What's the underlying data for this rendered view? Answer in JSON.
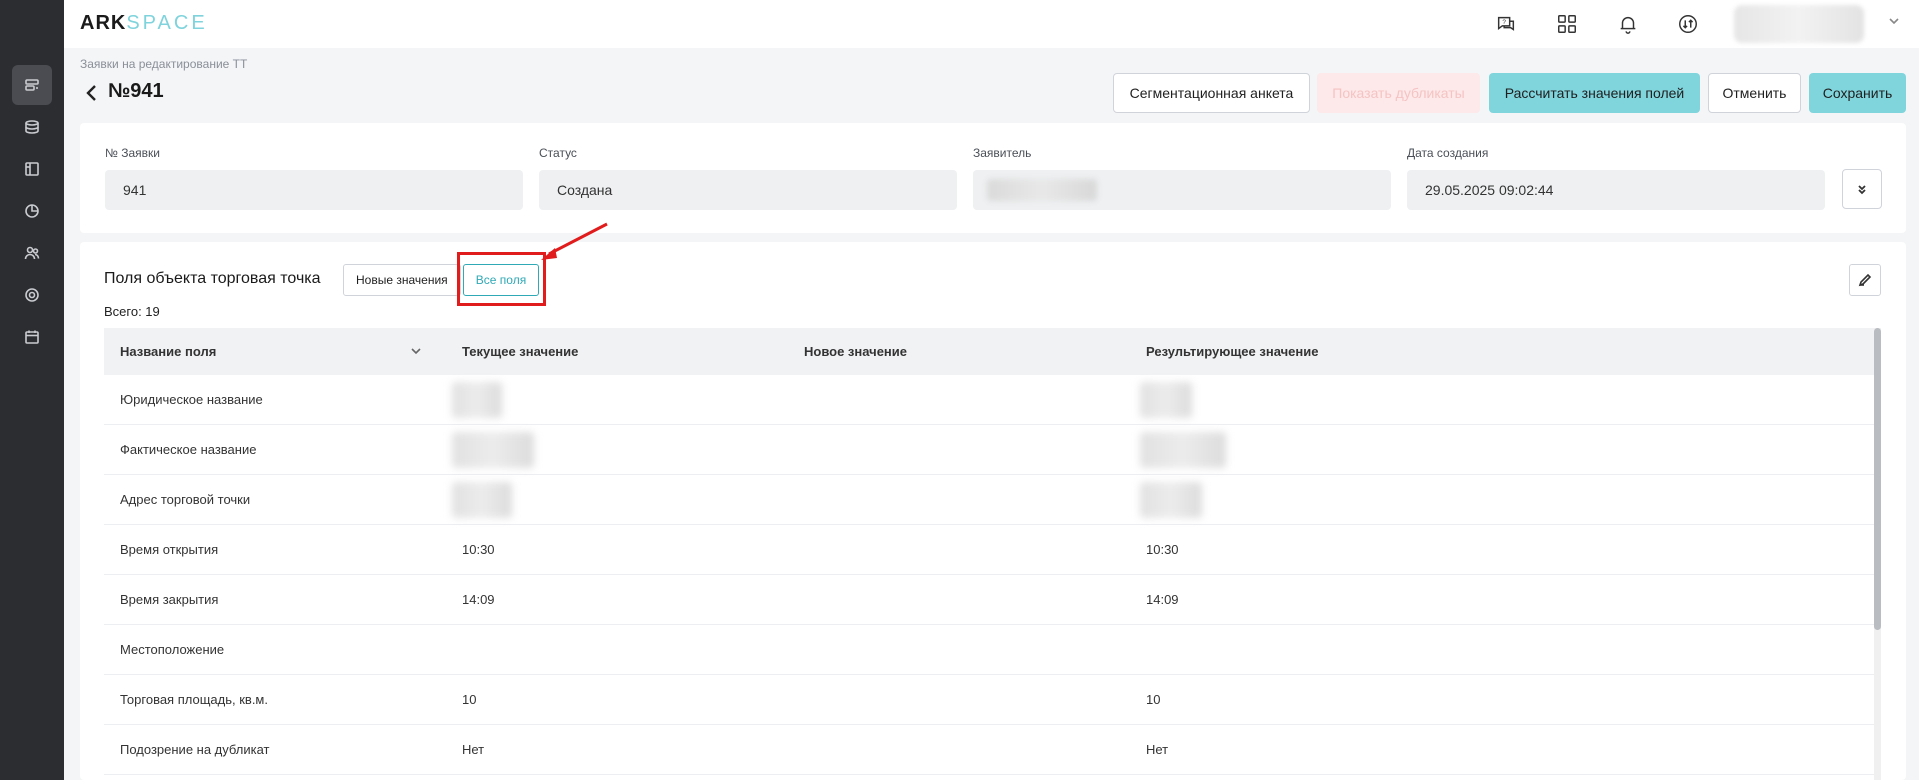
{
  "app": {
    "logo_ark": "ARK",
    "logo_space": "SPACE"
  },
  "header": {
    "icons": [
      "support-chat-icon",
      "apps-grid-icon",
      "bell-icon",
      "sync-icon"
    ]
  },
  "sidebar": {
    "items": [
      "requests-icon",
      "database-icon",
      "layout-icon",
      "analytics-icon",
      "users-icon",
      "settings-icon",
      "calendar-icon"
    ],
    "active_index": 0
  },
  "page": {
    "breadcrumb": "Заявки на редактирование ТТ",
    "title": "№941"
  },
  "toolbar": {
    "segmentation": "Сегментационная анкета",
    "show_duplicates": "Показать дубликаты",
    "calculate": "Рассчитать значения полей",
    "cancel": "Отменить",
    "save": "Сохранить"
  },
  "info": {
    "request_no_label": "№ Заявки",
    "request_no_value": "941",
    "status_label": "Статус",
    "status_value": "Создана",
    "applicant_label": "Заявитель",
    "created_label": "Дата создания",
    "created_value": "29.05.2025 09:02:44"
  },
  "fields": {
    "section_title": "Поля объекта торговая точка",
    "toggle_new": "Новые значения",
    "toggle_all": "Все поля",
    "total": "Всего: 19",
    "columns": [
      "Название поля",
      "Текущее значение",
      "Новое значение",
      "Результирующее значение"
    ],
    "rows": [
      {
        "name": "Юридическое название",
        "current": "",
        "new": "",
        "result": ""
      },
      {
        "name": "Фактическое название",
        "current": "",
        "new": "",
        "result": ""
      },
      {
        "name": "Адрес торговой точки",
        "current": "",
        "new": "",
        "result": ""
      },
      {
        "name": "Время открытия",
        "current": "10:30",
        "new": "",
        "result": "10:30"
      },
      {
        "name": "Время закрытия",
        "current": "14:09",
        "new": "",
        "result": "14:09"
      },
      {
        "name": "Местоположение",
        "current": "",
        "new": "",
        "result": ""
      },
      {
        "name": "Торговая площадь, кв.м.",
        "current": "10",
        "new": "",
        "result": "10"
      },
      {
        "name": "Подозрение на дубликат",
        "current": "Нет",
        "new": "",
        "result": "Нет"
      }
    ]
  },
  "colors": {
    "accent": "#80d5dd",
    "accent_text": "#2fa9b6",
    "highlight": "#e01c1c",
    "sidebar_bg": "#2b2d31"
  }
}
